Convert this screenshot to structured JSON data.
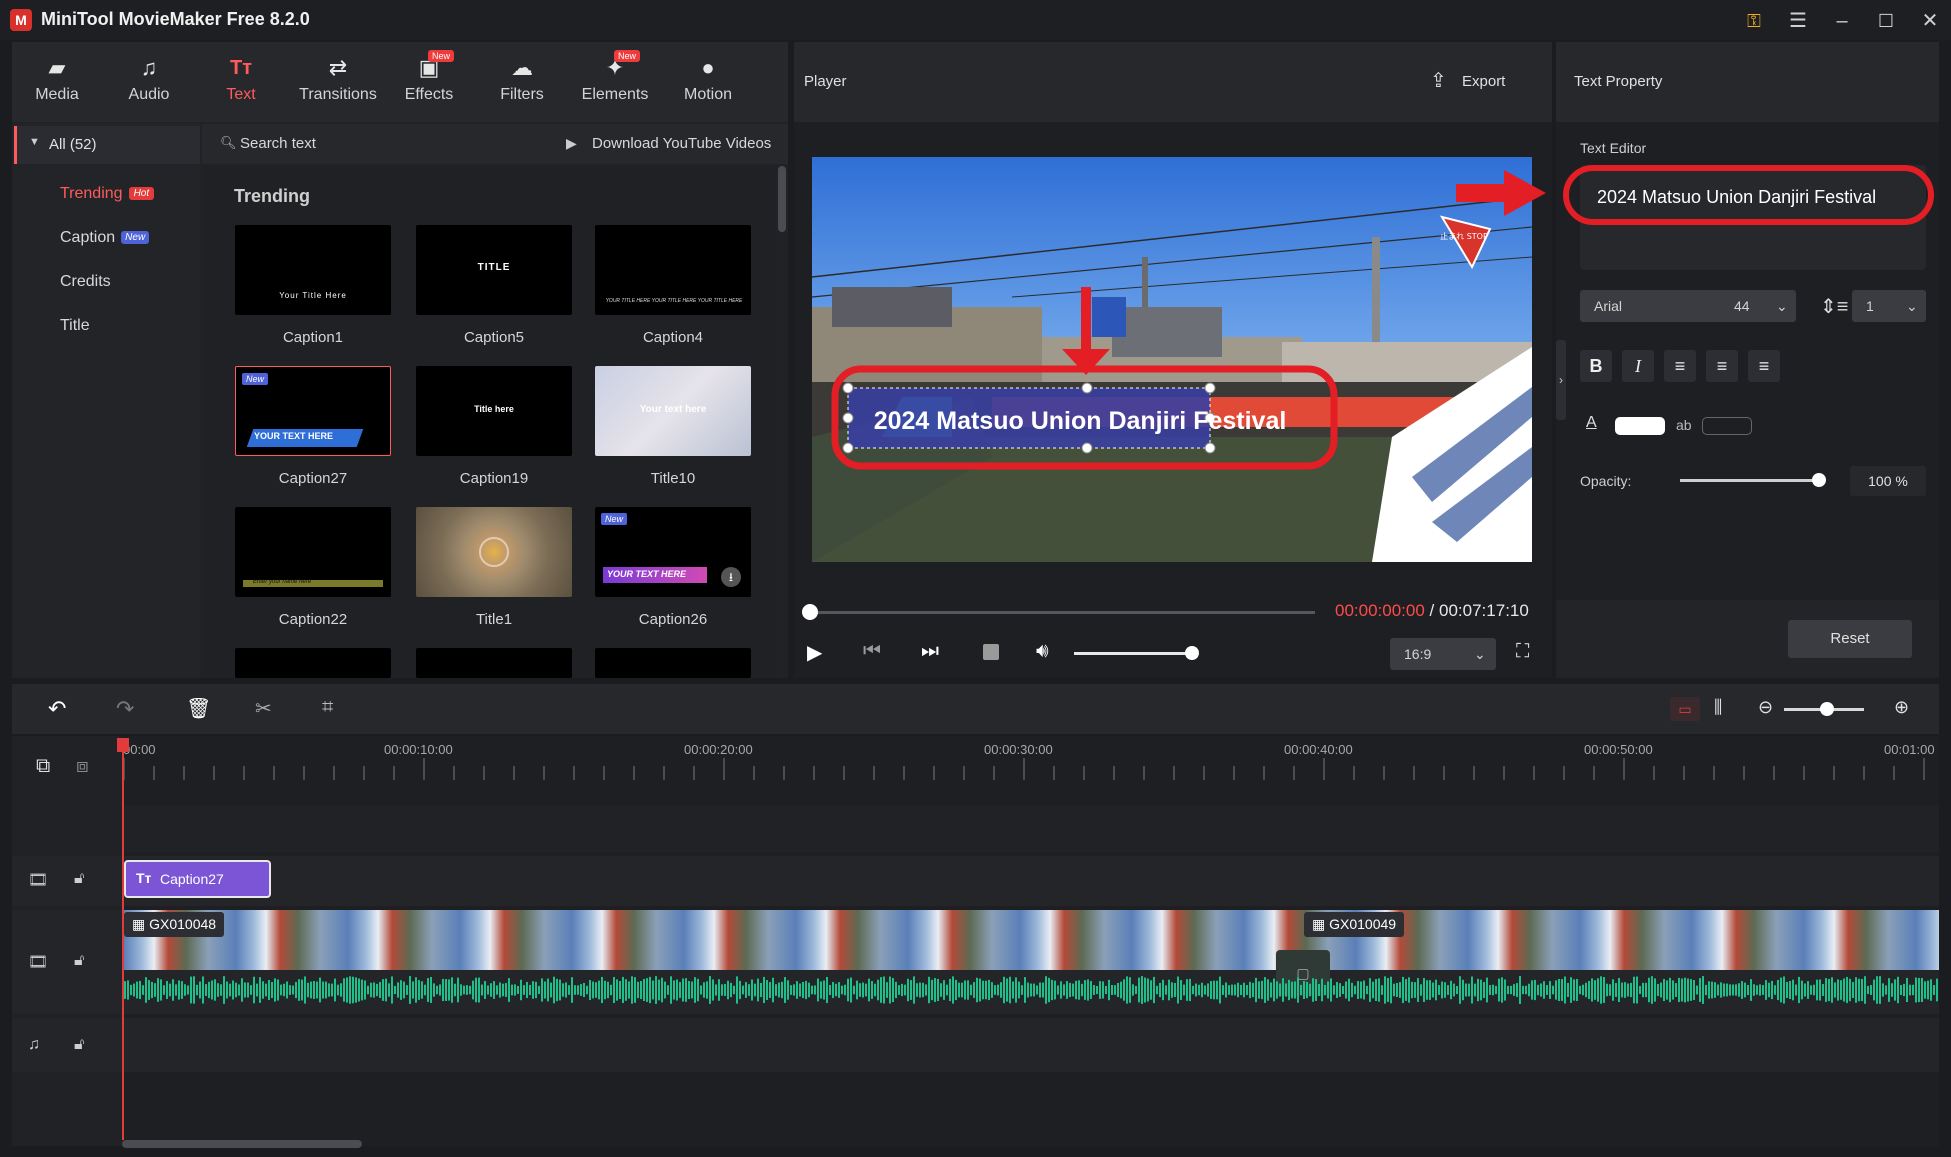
{
  "app": {
    "title": "MiniTool MovieMaker Free 8.2.0",
    "logo_icon": "minitool-logo"
  },
  "toolbar": {
    "items": [
      {
        "label": "Media",
        "icon": "folder-icon",
        "active": false
      },
      {
        "label": "Audio",
        "icon": "music-note-icon",
        "active": false
      },
      {
        "label": "Text",
        "icon": "text-icon",
        "active": true
      },
      {
        "label": "Transitions",
        "icon": "transitions-icon",
        "active": false
      },
      {
        "label": "Effects",
        "icon": "effects-icon",
        "active": false,
        "badge": "New"
      },
      {
        "label": "Filters",
        "icon": "filters-icon",
        "active": false
      },
      {
        "label": "Elements",
        "icon": "elements-icon",
        "active": false,
        "badge": "New"
      },
      {
        "label": "Motion",
        "icon": "motion-icon",
        "active": false
      }
    ]
  },
  "categories": {
    "all_label": "All (52)",
    "items": [
      {
        "label": "Trending",
        "badge": "Hot",
        "active": true
      },
      {
        "label": "Caption",
        "badge": "New"
      },
      {
        "label": "Credits"
      },
      {
        "label": "Title"
      }
    ]
  },
  "search": {
    "placeholder": "Search text",
    "download_label": "Download YouTube Videos"
  },
  "grid": {
    "section_title": "Trending",
    "items": [
      {
        "name": "Caption1",
        "thumb_text": "Your  Title Here"
      },
      {
        "name": "Caption5",
        "thumb_text": "TITLE"
      },
      {
        "name": "Caption4",
        "thumb_text": "YOUR TITLE HERE YOUR TITLE HERE YOUR TITLE HERE"
      },
      {
        "name": "Caption27",
        "thumb_text": "YOUR TEXT HERE",
        "badge": "New"
      },
      {
        "name": "Caption19",
        "thumb_text": "Title here"
      },
      {
        "name": "Title10",
        "thumb_text": "Your text here"
      },
      {
        "name": "Caption22",
        "thumb_text": "Enter your name here"
      },
      {
        "name": "Title1",
        "thumb_text": ""
      },
      {
        "name": "Caption26",
        "thumb_text": "YOUR TEXT HERE",
        "badge": "New"
      }
    ]
  },
  "player": {
    "title": "Player",
    "export_label": "Export",
    "overlay_text": "2024 Matsuo Union Danjiri Festival",
    "sign_text": "止まれ STOP",
    "current_time": "00:00:00:00",
    "separator": "/",
    "total_time": "00:07:17:10",
    "aspect": "16:9",
    "volume_level": 0.7,
    "position": 0
  },
  "properties": {
    "title": "Text Property",
    "editor_label": "Text Editor",
    "editor_value": "2024 Matsuo Union Danjiri Festival",
    "font": "Arial",
    "size": "44",
    "line_spacing": "1",
    "text_color": "#ffffff",
    "bg_label": "ab",
    "opacity_label": "Opacity:",
    "opacity_value": "100 %",
    "opacity_level": 1.0,
    "reset_label": "Reset"
  },
  "timeline": {
    "ruler_labels": [
      "00:00",
      "00:00:10:00",
      "00:00:20:00",
      "00:00:30:00",
      "00:00:40:00",
      "00:00:50:00",
      "00:01:00"
    ],
    "caption_clip": "Caption27",
    "video_clips": [
      "GX010048",
      "GX010049"
    ],
    "zoom_level": 0.55
  },
  "colors": {
    "accent": "#ff5b5b",
    "highlight": "#e31e24",
    "caption_clip": "#7b55d6",
    "audio_wave": "#1fbf8a",
    "playhead": "#e23b3b"
  }
}
